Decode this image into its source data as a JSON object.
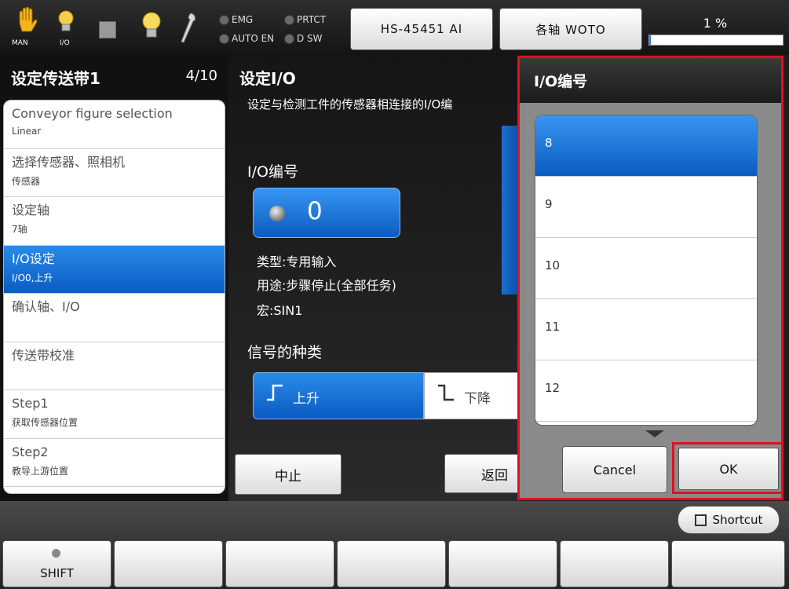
{
  "top": {
    "icons": [
      "hand-icon",
      "io-bulb-icon",
      "stop-square-icon",
      "bulb-icon",
      "wrench-icon"
    ],
    "man_label": "MAN",
    "io_label": "I/O",
    "status": {
      "emg": "EMG",
      "prtct": "PRTCT",
      "auto_en": "AUTO EN",
      "dsw": "D SW"
    },
    "robot_button": "HS-45451 AI",
    "axis_button": "各轴 WOTO",
    "speed_text": "1 %",
    "speed_value": 1,
    "speed_fill_color": "#2a7de1"
  },
  "left": {
    "title": "设定传送带1",
    "page": "4/10",
    "steps": [
      {
        "title": "Conveyor figure selection",
        "sub": "Linear"
      },
      {
        "title": "选择传感器、照相机",
        "sub": "传感器"
      },
      {
        "title": "设定轴",
        "sub": "7轴"
      },
      {
        "title": "I/O设定",
        "sub": "I/O0,上升"
      },
      {
        "title": "确认轴、I/O",
        "sub": ""
      },
      {
        "title": "传送带校准",
        "sub": ""
      },
      {
        "title": "Step1",
        "sub": "获取传感器位置"
      },
      {
        "title": "Step2",
        "sub": "教导上游位置"
      }
    ],
    "selected_index": 3,
    "selected_color": "#1a6fd6"
  },
  "main": {
    "title": "设定I/O",
    "description": "设定与检测工件的传感器相连接的I/O编",
    "io_label": "I/O编号",
    "io_value": "0",
    "type_line": "类型:专用输入",
    "usage_line": "用途:步骤停止(全部任务)",
    "macro_line": "宏:SIN1",
    "signal_label": "信号的种类",
    "signal_rise": "上升",
    "signal_fall": "下降",
    "abort_button": "中止",
    "back_button": "返回"
  },
  "dialog": {
    "title": "I/O编号",
    "options": [
      "8",
      "9",
      "10",
      "11",
      "12"
    ],
    "selected_option": "8",
    "cancel_button": "Cancel",
    "ok_button": "OK",
    "highlight_color": "#e01020"
  },
  "bottom": {
    "shortcut_button": "Shortcut",
    "shift_key": "SHIFT"
  }
}
